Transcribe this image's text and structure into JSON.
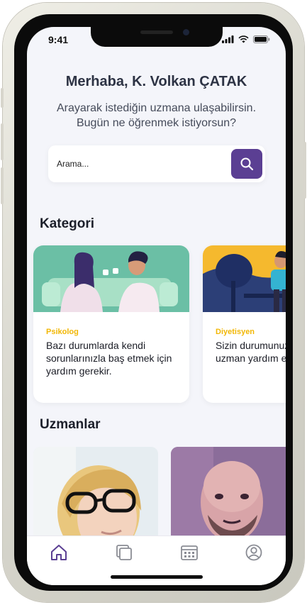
{
  "status_bar": {
    "time": "9:41"
  },
  "greeting": {
    "title": "Merhaba, K. Volkan ÇATAK",
    "subtitle": "Arayarak istediğin uzmana ulaşabilirsin. Bugün ne öğrenmek istiyorsun?"
  },
  "search": {
    "placeholder": "Arama...",
    "icon": "search-icon"
  },
  "categories": {
    "heading": "Kategori",
    "items": [
      {
        "label": "Psikolog",
        "description": "Bazı durumlarda kendi sorunlarınızla baş etmek için yardım gerekir."
      },
      {
        "label": "Diyetisyen",
        "description": "Sizin durumunuz farklı olabilir, uzman yardım edecek."
      }
    ]
  },
  "experts": {
    "heading": "Uzmanlar"
  },
  "nav": {
    "items": [
      "home-icon",
      "pages-icon",
      "calendar-icon",
      "profile-icon"
    ],
    "active": "home-icon"
  },
  "colors": {
    "accent": "#5b3f93",
    "category_label": "#f2b705",
    "background": "#f4f5fa"
  }
}
